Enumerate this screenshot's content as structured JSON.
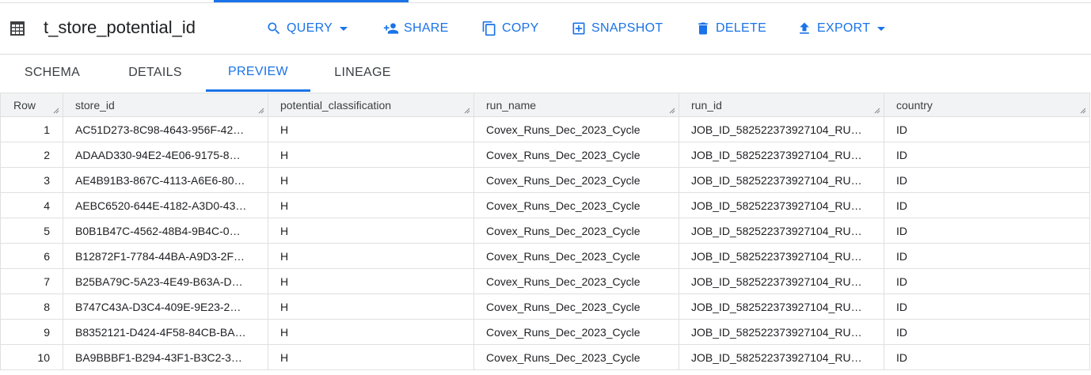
{
  "header": {
    "title": "t_store_potential_id",
    "actions": [
      {
        "label": "QUERY",
        "icon": "search-icon",
        "dropdown": true
      },
      {
        "label": "SHARE",
        "icon": "person-add-icon",
        "dropdown": false
      },
      {
        "label": "COPY",
        "icon": "copy-icon",
        "dropdown": false
      },
      {
        "label": "SNAPSHOT",
        "icon": "snapshot-icon",
        "dropdown": false
      },
      {
        "label": "DELETE",
        "icon": "trash-icon",
        "dropdown": false
      },
      {
        "label": "EXPORT",
        "icon": "upload-icon",
        "dropdown": true
      }
    ]
  },
  "tabs": [
    {
      "label": "SCHEMA",
      "active": false
    },
    {
      "label": "DETAILS",
      "active": false
    },
    {
      "label": "PREVIEW",
      "active": true
    },
    {
      "label": "LINEAGE",
      "active": false
    }
  ],
  "table": {
    "columns": [
      "Row",
      "store_id",
      "potential_classification",
      "run_name",
      "run_id",
      "country"
    ],
    "rows": [
      [
        "1",
        "AC51D273-8C98-4643-956F-42…",
        "H",
        "Covex_Runs_Dec_2023_Cycle",
        "JOB_ID_582522373927104_RU…",
        "ID"
      ],
      [
        "2",
        "ADAAD330-94E2-4E06-9175-8…",
        "H",
        "Covex_Runs_Dec_2023_Cycle",
        "JOB_ID_582522373927104_RU…",
        "ID"
      ],
      [
        "3",
        "AE4B91B3-867C-4113-A6E6-80…",
        "H",
        "Covex_Runs_Dec_2023_Cycle",
        "JOB_ID_582522373927104_RU…",
        "ID"
      ],
      [
        "4",
        "AEBC6520-644E-4182-A3D0-43…",
        "H",
        "Covex_Runs_Dec_2023_Cycle",
        "JOB_ID_582522373927104_RU…",
        "ID"
      ],
      [
        "5",
        "B0B1B47C-4562-48B4-9B4C-0…",
        "H",
        "Covex_Runs_Dec_2023_Cycle",
        "JOB_ID_582522373927104_RU…",
        "ID"
      ],
      [
        "6",
        "B12872F1-7784-44BA-A9D3-2F…",
        "H",
        "Covex_Runs_Dec_2023_Cycle",
        "JOB_ID_582522373927104_RU…",
        "ID"
      ],
      [
        "7",
        "B25BA79C-5A23-4E49-B63A-D…",
        "H",
        "Covex_Runs_Dec_2023_Cycle",
        "JOB_ID_582522373927104_RU…",
        "ID"
      ],
      [
        "8",
        "B747C43A-D3C4-409E-9E23-2…",
        "H",
        "Covex_Runs_Dec_2023_Cycle",
        "JOB_ID_582522373927104_RU…",
        "ID"
      ],
      [
        "9",
        "B8352121-D424-4F58-84CB-BA…",
        "H",
        "Covex_Runs_Dec_2023_Cycle",
        "JOB_ID_582522373927104_RU…",
        "ID"
      ],
      [
        "10",
        "BA9BBBF1-B294-43F1-B3C2-3…",
        "H",
        "Covex_Runs_Dec_2023_Cycle",
        "JOB_ID_582522373927104_RU…",
        "ID"
      ]
    ]
  }
}
